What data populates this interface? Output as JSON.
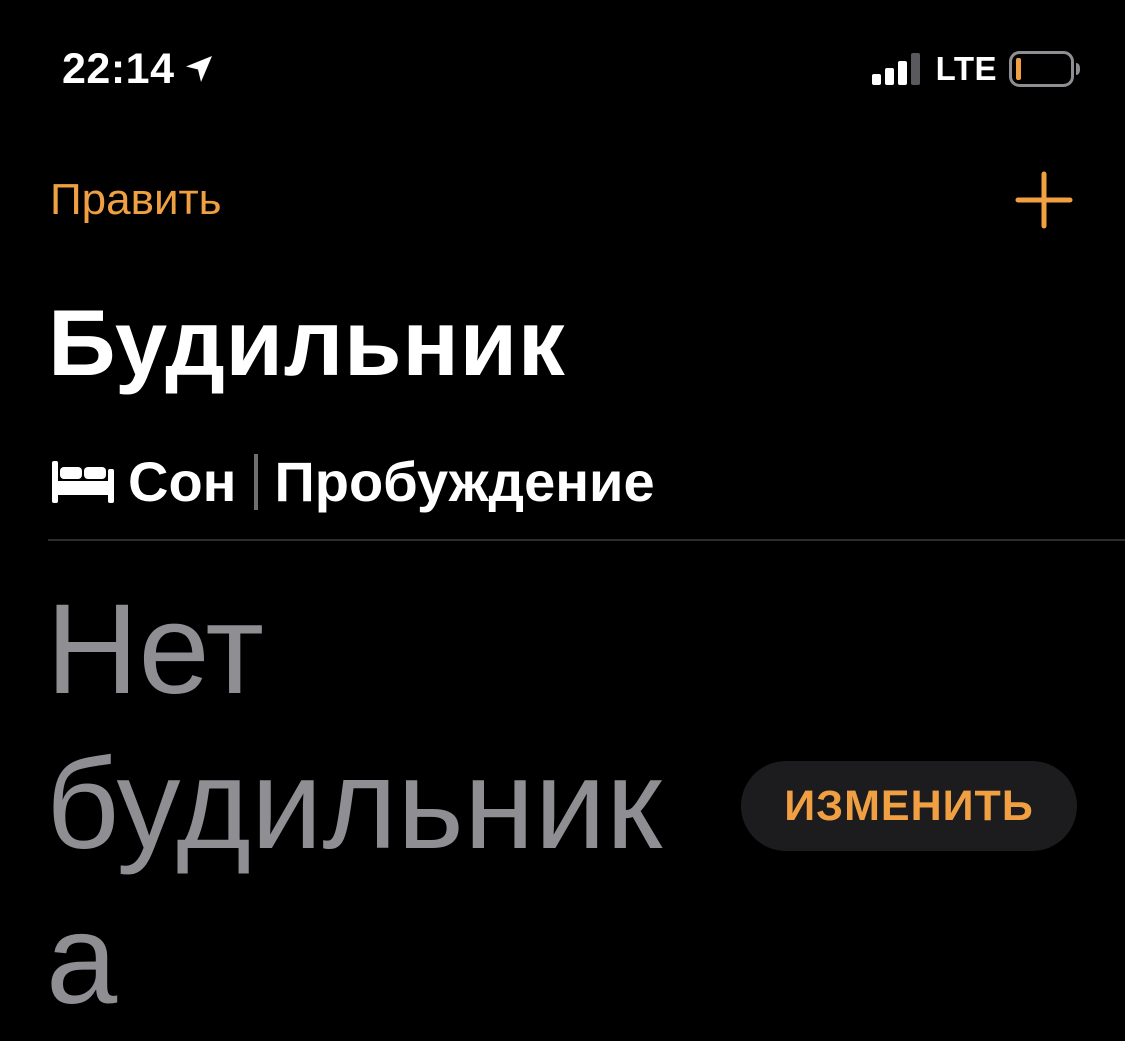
{
  "status_bar": {
    "time": "22:14",
    "network": "LTE",
    "icons": {
      "location": "location-arrow-icon",
      "signal": "cellular-signal-icon",
      "battery": "battery-low-icon"
    }
  },
  "nav": {
    "edit_label": "Править",
    "add_icon": "plus-icon"
  },
  "page": {
    "title": "Будильник"
  },
  "sleep": {
    "icon": "bed-icon",
    "label": "Сон",
    "separator": "|",
    "wake_label": "Пробуждение"
  },
  "alarm": {
    "empty_text_line1": "Нет",
    "empty_text_line2": "будильник",
    "empty_text_line3": "а",
    "change_label": "ИЗМЕНИТЬ"
  },
  "colors": {
    "accent": "#F0A042",
    "background": "#000000",
    "muted_text": "#8e8e93",
    "button_bg": "#1c1c1e"
  }
}
